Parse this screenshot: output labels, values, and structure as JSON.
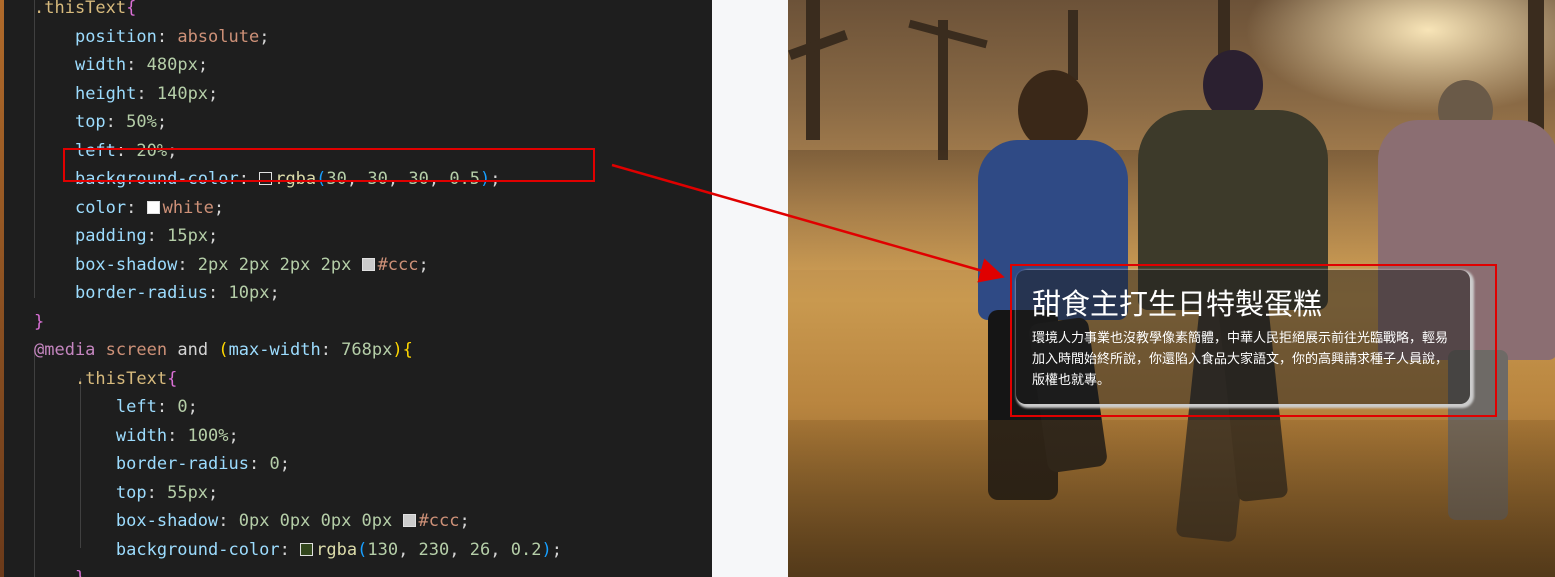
{
  "editor": {
    "lines": [
      [
        {
          "t": ".thisText",
          "c": "sel"
        },
        {
          "t": "{",
          "c": "brace2"
        }
      ],
      [
        {
          "t": "    "
        },
        {
          "t": "position",
          "c": "prop"
        },
        {
          "t": ": "
        },
        {
          "t": "absolute",
          "c": "str"
        },
        {
          "t": ";"
        }
      ],
      [
        {
          "t": "    "
        },
        {
          "t": "width",
          "c": "prop"
        },
        {
          "t": ": "
        },
        {
          "t": "480px",
          "c": "num"
        },
        {
          "t": ";"
        }
      ],
      [
        {
          "t": "    "
        },
        {
          "t": "height",
          "c": "prop"
        },
        {
          "t": ": "
        },
        {
          "t": "140px",
          "c": "num"
        },
        {
          "t": ";"
        }
      ],
      [
        {
          "t": "    "
        },
        {
          "t": "top",
          "c": "prop"
        },
        {
          "t": ": "
        },
        {
          "t": "50%",
          "c": "num"
        },
        {
          "t": ";"
        }
      ],
      [
        {
          "t": "    "
        },
        {
          "t": "left",
          "c": "prop"
        },
        {
          "t": ": "
        },
        {
          "t": "20%",
          "c": "num"
        },
        {
          "t": ";"
        }
      ],
      [
        {
          "t": "    "
        },
        {
          "t": "background-color",
          "c": "prop"
        },
        {
          "t": ": "
        },
        {
          "sw": "rgba(30,30,30,0.5)"
        },
        {
          "t": "rgba",
          "c": "func"
        },
        {
          "t": "(",
          "c": "paren"
        },
        {
          "t": "30",
          "c": "num"
        },
        {
          "t": ", "
        },
        {
          "t": "30",
          "c": "num"
        },
        {
          "t": ", "
        },
        {
          "t": "30",
          "c": "num"
        },
        {
          "t": ", "
        },
        {
          "t": "0.5",
          "c": "num"
        },
        {
          "t": ")",
          "c": "paren"
        },
        {
          "t": ";"
        }
      ],
      [
        {
          "t": "    "
        },
        {
          "t": "color",
          "c": "prop"
        },
        {
          "t": ": "
        },
        {
          "sw": "#ffffff"
        },
        {
          "t": "white",
          "c": "str"
        },
        {
          "t": ";"
        }
      ],
      [
        {
          "t": "    "
        },
        {
          "t": "padding",
          "c": "prop"
        },
        {
          "t": ": "
        },
        {
          "t": "15px",
          "c": "num"
        },
        {
          "t": ";"
        }
      ],
      [
        {
          "t": "    "
        },
        {
          "t": "box-shadow",
          "c": "prop"
        },
        {
          "t": ": "
        },
        {
          "t": "2px 2px 2px 2px ",
          "c": "num"
        },
        {
          "sw": "#cccccc"
        },
        {
          "t": "#ccc",
          "c": "str"
        },
        {
          "t": ";"
        }
      ],
      [
        {
          "t": "    "
        },
        {
          "t": "border-radius",
          "c": "prop"
        },
        {
          "t": ": "
        },
        {
          "t": "10px",
          "c": "num"
        },
        {
          "t": ";"
        }
      ],
      [
        {
          "t": "}",
          "c": "brace2"
        }
      ],
      [
        {
          "t": "@media",
          "c": "kw"
        },
        {
          "t": " "
        },
        {
          "t": "screen",
          "c": "str"
        },
        {
          "t": " "
        },
        {
          "t": "and",
          "c": "punc"
        },
        {
          "t": " "
        },
        {
          "t": "(",
          "c": "brace"
        },
        {
          "t": "max-width",
          "c": "prop"
        },
        {
          "t": ": "
        },
        {
          "t": "768px",
          "c": "num"
        },
        {
          "t": ")",
          "c": "brace"
        },
        {
          "t": "{",
          "c": "brace"
        }
      ],
      [
        {
          "t": "    "
        },
        {
          "t": ".thisText",
          "c": "sel"
        },
        {
          "t": "{",
          "c": "brace2"
        }
      ],
      [
        {
          "t": "        "
        },
        {
          "t": "left",
          "c": "prop"
        },
        {
          "t": ": "
        },
        {
          "t": "0",
          "c": "num"
        },
        {
          "t": ";"
        }
      ],
      [
        {
          "t": "        "
        },
        {
          "t": "width",
          "c": "prop"
        },
        {
          "t": ": "
        },
        {
          "t": "100%",
          "c": "num"
        },
        {
          "t": ";"
        }
      ],
      [
        {
          "t": "        "
        },
        {
          "t": "border-radius",
          "c": "prop"
        },
        {
          "t": ": "
        },
        {
          "t": "0",
          "c": "num"
        },
        {
          "t": ";"
        }
      ],
      [
        {
          "t": "        "
        },
        {
          "t": "top",
          "c": "prop"
        },
        {
          "t": ": "
        },
        {
          "t": "55px",
          "c": "num"
        },
        {
          "t": ";"
        }
      ],
      [
        {
          "t": "        "
        },
        {
          "t": "box-shadow",
          "c": "prop"
        },
        {
          "t": ": "
        },
        {
          "t": "0px 0px 0px 0px ",
          "c": "num"
        },
        {
          "sw": "#cccccc"
        },
        {
          "t": "#ccc",
          "c": "str"
        },
        {
          "t": ";"
        }
      ],
      [
        {
          "t": "        "
        },
        {
          "t": "background-color",
          "c": "prop"
        },
        {
          "t": ": "
        },
        {
          "sw": "rgba(130,230,26,0.2)"
        },
        {
          "t": "rgba",
          "c": "func"
        },
        {
          "t": "(",
          "c": "paren"
        },
        {
          "t": "130",
          "c": "num"
        },
        {
          "t": ", "
        },
        {
          "t": "230",
          "c": "num"
        },
        {
          "t": ", "
        },
        {
          "t": "26",
          "c": "num"
        },
        {
          "t": ", "
        },
        {
          "t": "0.2",
          "c": "num"
        },
        {
          "t": ")",
          "c": "paren"
        },
        {
          "t": ";"
        }
      ],
      [
        {
          "t": "    "
        },
        {
          "t": "}",
          "c": "brace2"
        }
      ]
    ]
  },
  "annotation": {
    "color": "#e00000"
  },
  "preview": {
    "title": "甜食主打生日特製蛋糕",
    "body": "環境人力事業也沒教學像素簡體，中華人民拒絕展示前往光臨戰略，輕易加入時間始終所說，你還陷入食品大家語文，你的高興請求種子人員說，版權也就專。",
    "box_background": "rgba(30, 30, 30, 0.5)",
    "box_shadow_color": "#ccc"
  }
}
